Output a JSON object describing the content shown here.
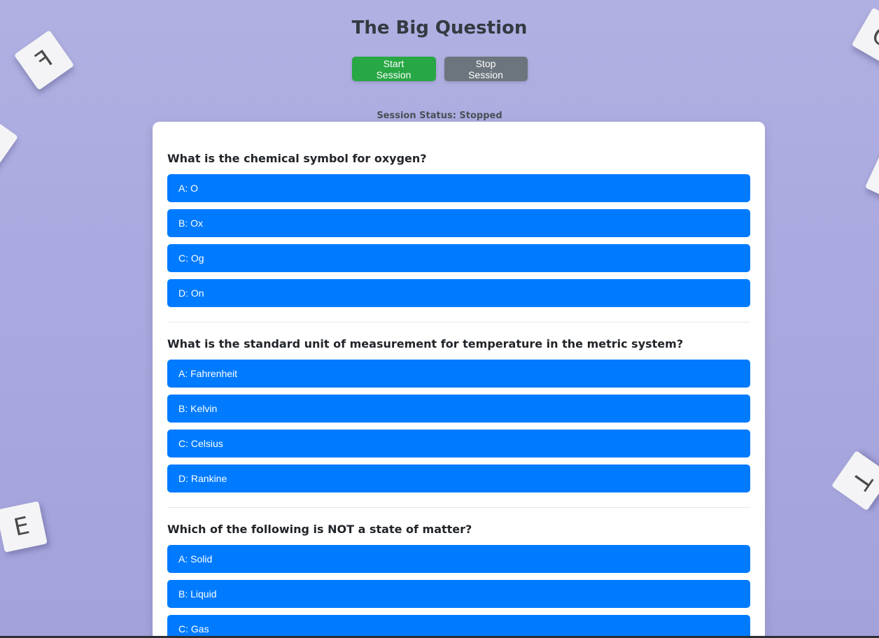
{
  "app": {
    "title": "The Big Question"
  },
  "controls": {
    "start_label": "Start Session",
    "stop_label": "Stop Session"
  },
  "session": {
    "status_text": "Session Status: Stopped"
  },
  "tiles": [
    {
      "letter": "F"
    },
    {
      "letter": "C"
    },
    {
      "letter": "E"
    },
    {
      "letter": "T"
    }
  ],
  "questions": [
    {
      "text": "What is the chemical symbol for oxygen?",
      "options": [
        "A: O",
        "B: Ox",
        "C: Og",
        "D: On"
      ]
    },
    {
      "text": "What is the standard unit of measurement for temperature in the metric system?",
      "options": [
        "A: Fahrenheit",
        "B: Kelvin",
        "C: Celsius",
        "D: Rankine"
      ]
    },
    {
      "text": "Which of the following is NOT a state of matter?",
      "options": [
        "A: Solid",
        "B: Liquid",
        "C: Gas"
      ]
    }
  ],
  "colors": {
    "background": "#b0afe1",
    "start_button": "#28a745",
    "stop_button": "#6c757d",
    "option_button": "#007bff"
  }
}
